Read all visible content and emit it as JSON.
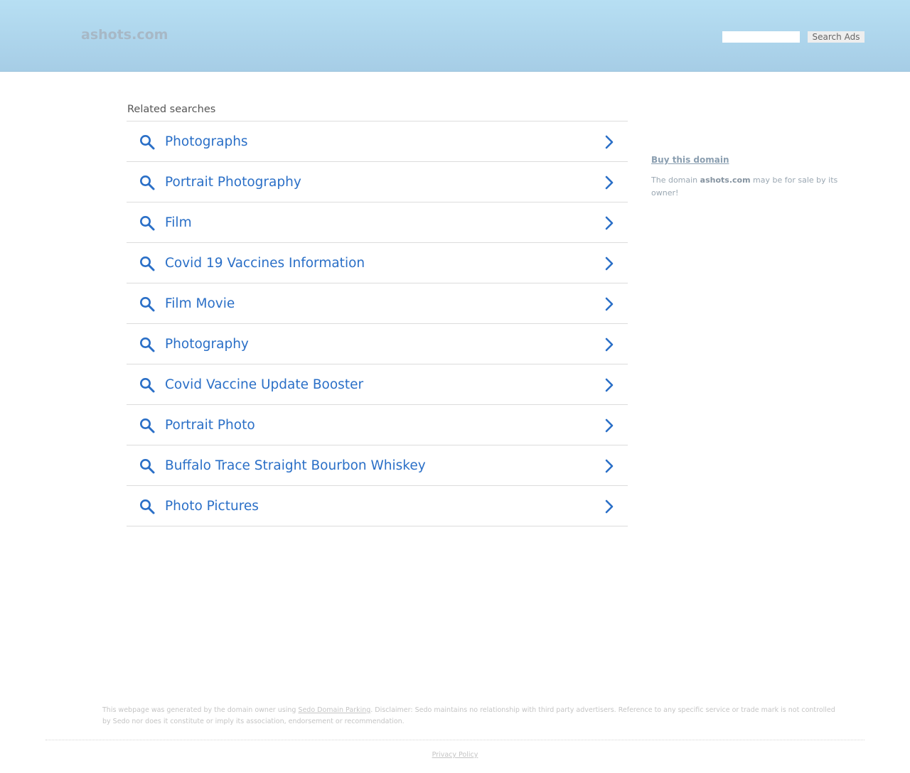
{
  "header": {
    "logo": "ashots.com",
    "search_placeholder": "",
    "search_button": "Search Ads",
    "accent": "#a6cde6"
  },
  "related": {
    "title": "Related searches",
    "link_color": "#2a6fc7",
    "items": [
      {
        "label": "Photographs"
      },
      {
        "label": "Portrait Photography"
      },
      {
        "label": "Film"
      },
      {
        "label": "Covid 19 Vaccines Information"
      },
      {
        "label": "Film Movie"
      },
      {
        "label": "Photography"
      },
      {
        "label": "Covid Vaccine Update Booster"
      },
      {
        "label": "Portrait Photo"
      },
      {
        "label": "Buffalo Trace Straight Bourbon Whiskey"
      },
      {
        "label": "Photo Pictures"
      }
    ],
    "item_icon": "search-icon",
    "item_arrow": "chevron-right-icon"
  },
  "sidebar": {
    "buy_link": "Buy this domain",
    "text_before": "The domain ",
    "domain": "ashots.com",
    "text_after": " may be for sale by its owner!"
  },
  "footer": {
    "disclaimer_before": "This webpage was generated by the domain owner using ",
    "disclaimer_link": "Sedo Domain Parking",
    "disclaimer_after": ". Disclaimer: Sedo maintains no relationship with third party advertisers. Reference to any specific service or trade mark is not controlled by Sedo nor does it constitute or imply its association, endorsement or recommendation.",
    "privacy": "Privacy Policy"
  }
}
